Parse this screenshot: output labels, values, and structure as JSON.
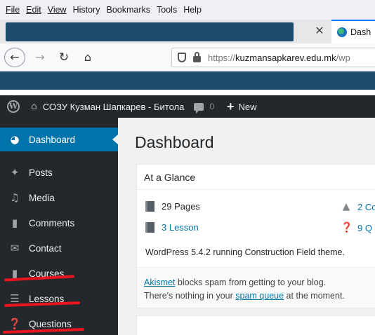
{
  "browser": {
    "menu": [
      "File",
      "Edit",
      "View",
      "History",
      "Bookmarks",
      "Tools",
      "Help"
    ],
    "tab_title": "Dash",
    "tab_close": "✕",
    "url_prefix": "https://",
    "url_host": "kuzmansapkarev.edu.mk",
    "url_path": "/wp"
  },
  "adminbar": {
    "site_name": "СОЗУ Кузман Шапкарев - Битола",
    "comment_count": "0",
    "new_label": "New"
  },
  "sidebar": {
    "items": [
      {
        "label": "Dashboard",
        "icon": "dashboard-icon",
        "active": true
      },
      {
        "label": "Posts",
        "icon": "pin-icon"
      },
      {
        "label": "Media",
        "icon": "media-icon"
      },
      {
        "label": "Comments",
        "icon": "comment-icon"
      },
      {
        "label": "Contact",
        "icon": "envelope-icon"
      },
      {
        "label": "Courses",
        "icon": "book-icon"
      },
      {
        "label": "Lessons",
        "icon": "list-icon"
      },
      {
        "label": "Questions",
        "icon": "question-icon"
      }
    ]
  },
  "main": {
    "title": "Dashboard",
    "glance": {
      "heading": "At a Glance",
      "pages": "29 Pages",
      "lesson": "3 Lesson",
      "courses": "2 Co",
      "questions": "9 Q",
      "version_text": "WordPress 5.4.2 running Construction Field theme.",
      "akismet_link": "Akismet",
      "akismet_text": " blocks spam from getting to your blog.",
      "akismet_line2_a": "There's nothing in your ",
      "spam_link": "spam queue",
      "akismet_line2_b": " at the moment."
    }
  },
  "colors": {
    "admin_bar": "#23282d",
    "active_menu": "#0073aa",
    "annotation_red": "#e8141f",
    "browser_toolbar": "#1e4c6b"
  }
}
